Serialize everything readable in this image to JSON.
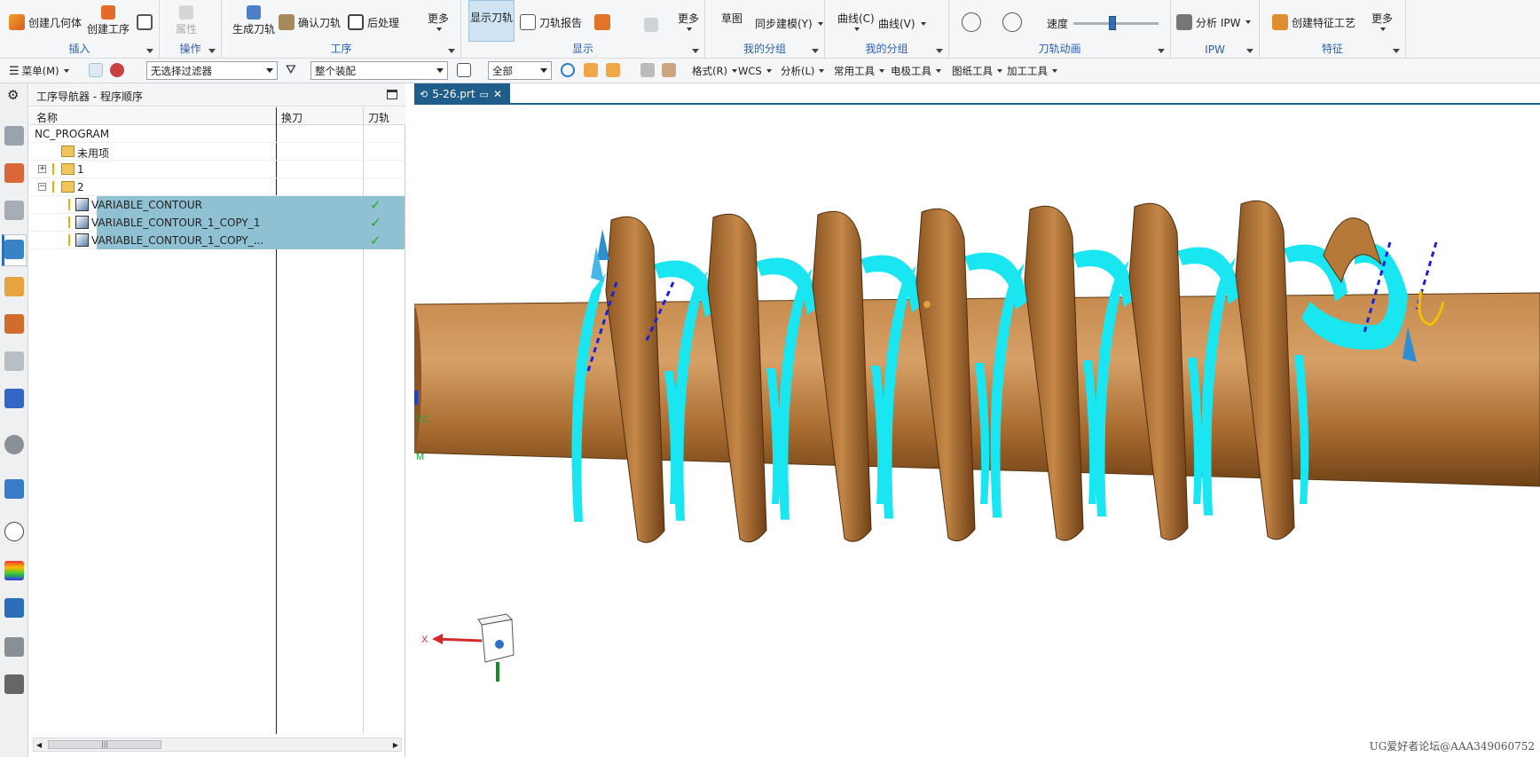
{
  "ribbon": {
    "groups": [
      {
        "label": "插入",
        "buttons": [
          "创建几何体",
          "创建工序"
        ]
      },
      {
        "label": "操作",
        "buttons": [
          "属性"
        ]
      },
      {
        "label": "工序",
        "buttons": [
          "生成刀轨",
          "确认刀轨",
          "后处理",
          "更多"
        ]
      },
      {
        "label": "显示",
        "buttons": [
          "显示刀轨",
          "刀轨报告",
          "更多"
        ]
      },
      {
        "label": "我的分组",
        "buttons": [
          "草图",
          "同步建模(Y)"
        ]
      },
      {
        "label": "我的分组",
        "buttons": [
          "曲线(C)",
          "曲线(V)"
        ]
      },
      {
        "label": "刀轨动画",
        "buttons": [
          "速度"
        ],
        "speed_level": 0.45
      },
      {
        "label": "IPW",
        "buttons": [
          "分析 IPW"
        ]
      },
      {
        "label": "特征",
        "buttons": [
          "创建特征工艺",
          "更多"
        ]
      }
    ]
  },
  "toolbar": {
    "menu_label": "菜单(M)",
    "filter_value": "无选择过滤器",
    "assembly_value": "整个装配",
    "scope_value": "全部",
    "menus": [
      "格式(R)",
      "WCS",
      "分析(L)",
      "常用工具",
      "电极工具",
      "图纸工具",
      "加工工具"
    ]
  },
  "navigator": {
    "title": "工序导航器 - 程序顺序",
    "columns": [
      "名称",
      "换刀",
      "刀轨"
    ],
    "rows": [
      {
        "name": "NC_PROGRAM",
        "level": 0,
        "type": "root"
      },
      {
        "name": "未用项",
        "level": 1,
        "type": "folder"
      },
      {
        "name": "1",
        "level": 1,
        "type": "folder",
        "expander": "+"
      },
      {
        "name": "2",
        "level": 1,
        "type": "folder",
        "expander": "−"
      },
      {
        "name": "VARIABLE_CONTOUR",
        "level": 2,
        "type": "operation",
        "selected": true,
        "toolpath": "✓"
      },
      {
        "name": "VARIABLE_CONTOUR_1_COPY_1",
        "level": 2,
        "type": "operation",
        "selected": true,
        "toolpath": "✓"
      },
      {
        "name": "VARIABLE_CONTOUR_1_COPY_...",
        "level": 2,
        "type": "operation",
        "selected": true,
        "toolpath": "✓"
      }
    ]
  },
  "document": {
    "tab_label": "5-26.prt"
  },
  "viewport": {
    "axis_x": "X",
    "triad_labels": [
      "YC",
      "M"
    ],
    "watermark": "UG爱好者论坛@AAA349060752"
  },
  "colors": {
    "part": "#b5793a",
    "toolpath": "#19e6f0",
    "selection": "#8fc1d2",
    "tab": "#1f5d8a"
  }
}
